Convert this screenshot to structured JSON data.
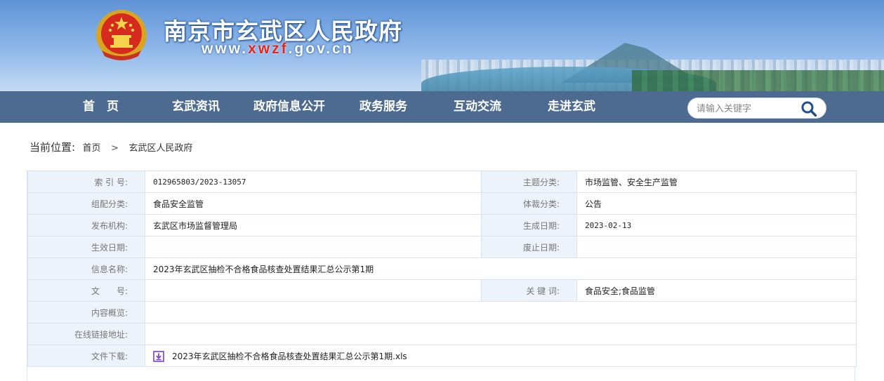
{
  "header": {
    "site_title": "南京市玄武区人民政府",
    "site_url_prefix": "www.",
    "site_url_red": "xwzf",
    "site_url_suffix": ".gov.cn"
  },
  "nav": {
    "items": [
      {
        "label": "首　页"
      },
      {
        "label": "玄武资讯"
      },
      {
        "label": "政府信息公开"
      },
      {
        "label": "政务服务"
      },
      {
        "label": "互动交流"
      },
      {
        "label": "走进玄武"
      }
    ],
    "search_placeholder": "请输入关键字"
  },
  "breadcrumb": {
    "label": "当前位置:",
    "items": [
      "首页",
      "玄武区人民政府"
    ],
    "separator": ">"
  },
  "info": {
    "rows": [
      {
        "k1": "索 引 号:",
        "v1": "012965803/2023-13057",
        "k2": "主题分类:",
        "v2": "市场监管、安全生产监管"
      },
      {
        "k1": "组配分类:",
        "v1": "食品安全监管",
        "k2": "体裁分类:",
        "v2": "公告"
      },
      {
        "k1": "发布机构:",
        "v1": "玄武区市场监督管理局",
        "k2": "生成日期:",
        "v2": "2023-02-13"
      },
      {
        "k1": "生效日期:",
        "v1": "",
        "k2": "废止日期:",
        "v2": ""
      },
      {
        "k1": "信息名称:",
        "v1": "2023年玄武区抽检不合格食品核查处置结果汇总公示第1期"
      },
      {
        "k1": "文　　号:",
        "v1": "",
        "k2": "关 键 词:",
        "v2": "食品安全;食品监管"
      },
      {
        "k1": "内容概览:",
        "v1": ""
      },
      {
        "k1": "在线链接地址:",
        "v1": ""
      },
      {
        "k1": "文件下载:",
        "v1": "2023年玄武区抽检不合格食品核查处置结果汇总公示第1期.xls"
      }
    ]
  },
  "colors": {
    "nav_bg": "#345682",
    "key_cell_bg": "#edf3fa",
    "border": "#dbe3ec",
    "download_icon": "#7b3fd6",
    "url_accent": "#e2261b"
  },
  "icons": {
    "emblem": "national-emblem-icon",
    "search": "search-icon",
    "download": "download-icon"
  }
}
